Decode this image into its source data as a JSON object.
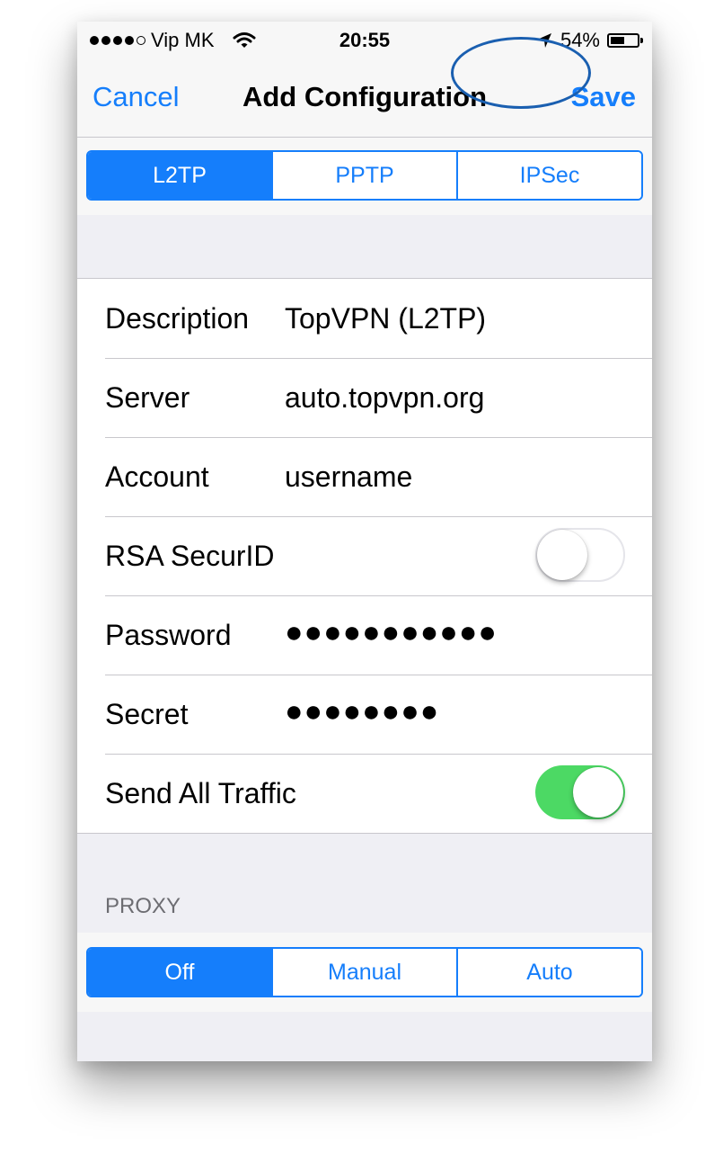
{
  "status_bar": {
    "carrier": "Vip MK",
    "time": "20:55",
    "battery_percent": "54%",
    "battery_level": 0.54
  },
  "nav": {
    "cancel": "Cancel",
    "title": "Add Configuration",
    "save": "Save"
  },
  "vpn_type": {
    "options": [
      "L2TP",
      "PPTP",
      "IPSec"
    ],
    "selected": "L2TP"
  },
  "fields": {
    "description": {
      "label": "Description",
      "value": "TopVPN (L2TP)"
    },
    "server": {
      "label": "Server",
      "value": "auto.topvpn.org"
    },
    "account": {
      "label": "Account",
      "value": "username"
    },
    "rsa_securid": {
      "label": "RSA SecurID",
      "on": false
    },
    "password": {
      "label": "Password",
      "value": "●●●●●●●●●●●"
    },
    "secret": {
      "label": "Secret",
      "value": "●●●●●●●●"
    },
    "send_all_traffic": {
      "label": "Send All Traffic",
      "on": true
    }
  },
  "proxy": {
    "header": "PROXY",
    "options": [
      "Off",
      "Manual",
      "Auto"
    ],
    "selected": "Off"
  },
  "colors": {
    "accent": "#157efb",
    "toggle_on": "#4cd964",
    "group_background": "#efeff4",
    "annotation_ring": "#1a5fb0"
  },
  "icons": [
    "signal-dots-icon",
    "wifi-icon",
    "location-arrow-icon",
    "battery-icon"
  ]
}
